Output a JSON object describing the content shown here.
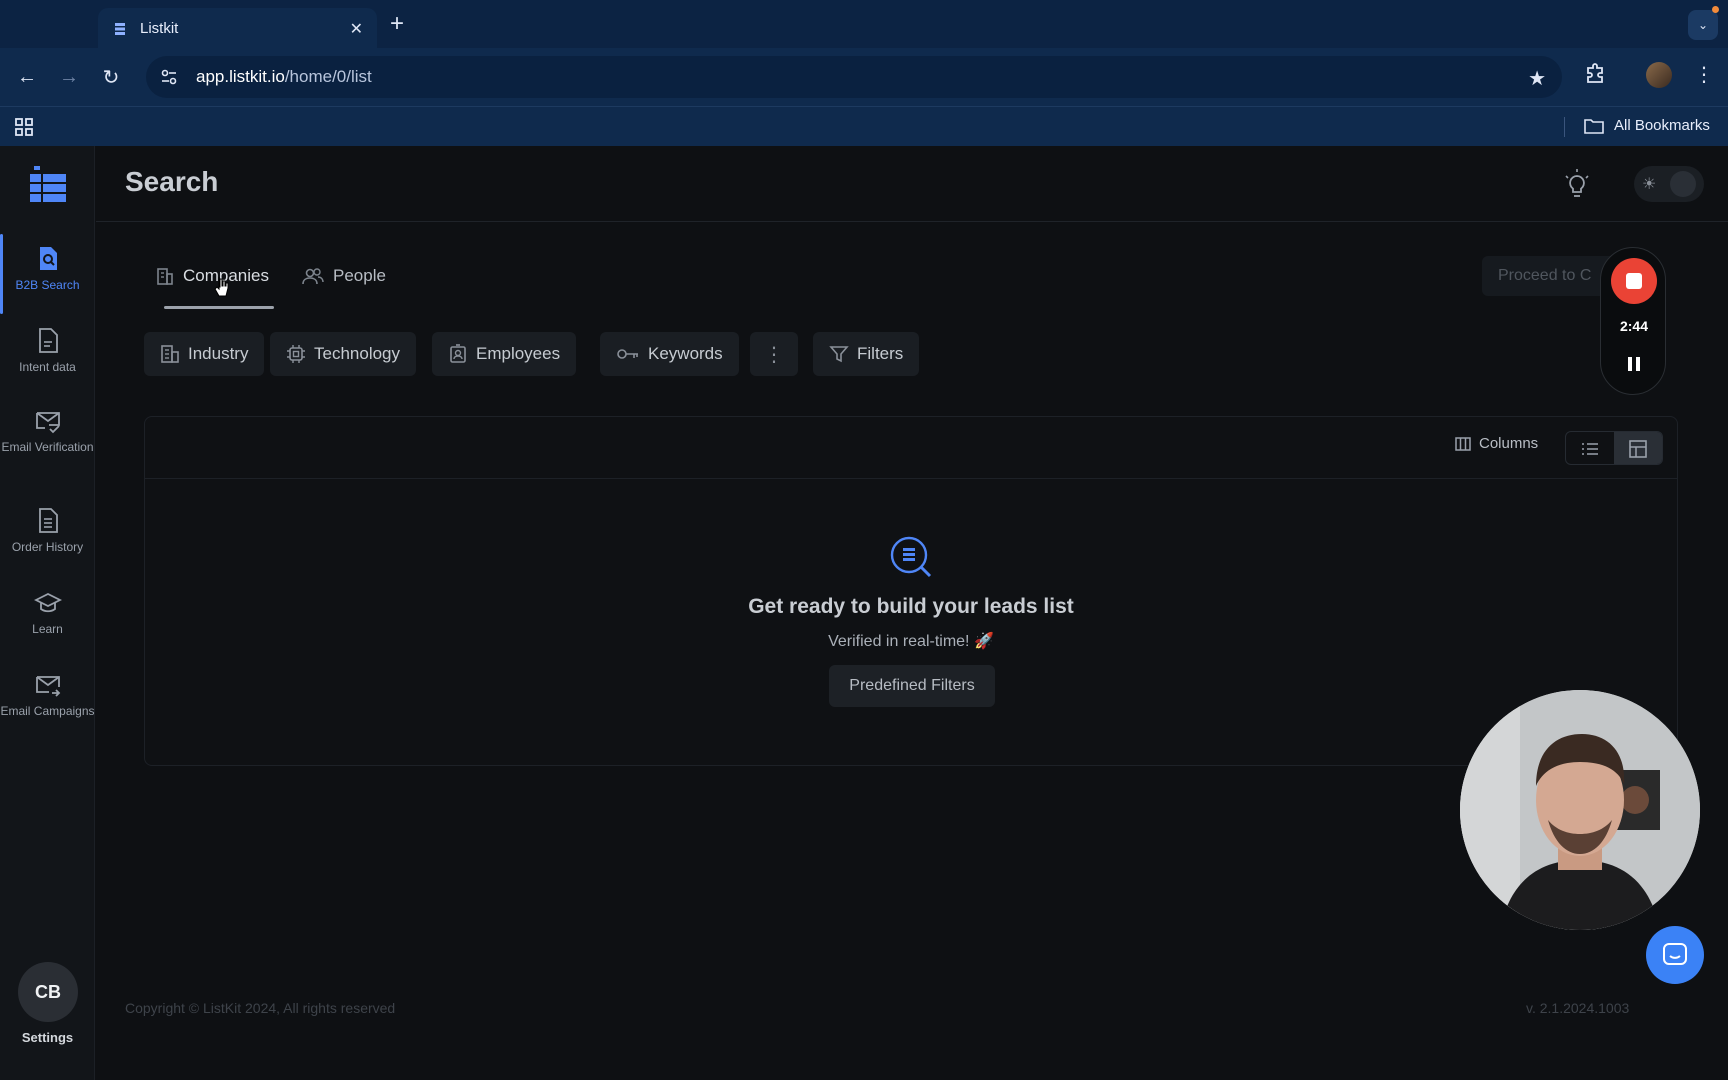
{
  "browser": {
    "tab_title": "Listkit",
    "url_host": "app.listkit.io",
    "url_path": "/home/0/list",
    "bookmarks_label": "All Bookmarks"
  },
  "sidebar": {
    "items": [
      {
        "label": "B2B Search",
        "icon": "search-doc-icon",
        "active": true
      },
      {
        "label": "Intent data",
        "icon": "document-icon"
      },
      {
        "label": "Email Verification",
        "icon": "mail-check-icon"
      },
      {
        "label": "Order History",
        "icon": "list-doc-icon"
      },
      {
        "label": "Learn",
        "icon": "graduation-cap-icon"
      },
      {
        "label": "Email Campaigns",
        "icon": "mail-send-icon"
      }
    ],
    "avatar_initials": "CB",
    "settings_label": "Settings"
  },
  "header": {
    "title": "Search"
  },
  "subtabs": {
    "companies": "Companies",
    "people": "People",
    "proceed": "Proceed to C"
  },
  "filters": {
    "industry": "Industry",
    "technology": "Technology",
    "employees": "Employees",
    "keywords": "Keywords",
    "filters": "Filters"
  },
  "panel": {
    "columns_label": "Columns",
    "empty_title": "Get ready to build your leads list",
    "empty_subtitle": "Verified in real-time! 🚀",
    "predefined_label": "Predefined Filters"
  },
  "footer": {
    "copyright": "Copyright © ListKit 2024, All rights reserved",
    "version": "v. 2.1.2024.1003"
  },
  "recorder": {
    "time": "2:44"
  },
  "colors": {
    "accent": "#4f86f7",
    "record": "#ea4335",
    "chat": "#3b82f6"
  }
}
